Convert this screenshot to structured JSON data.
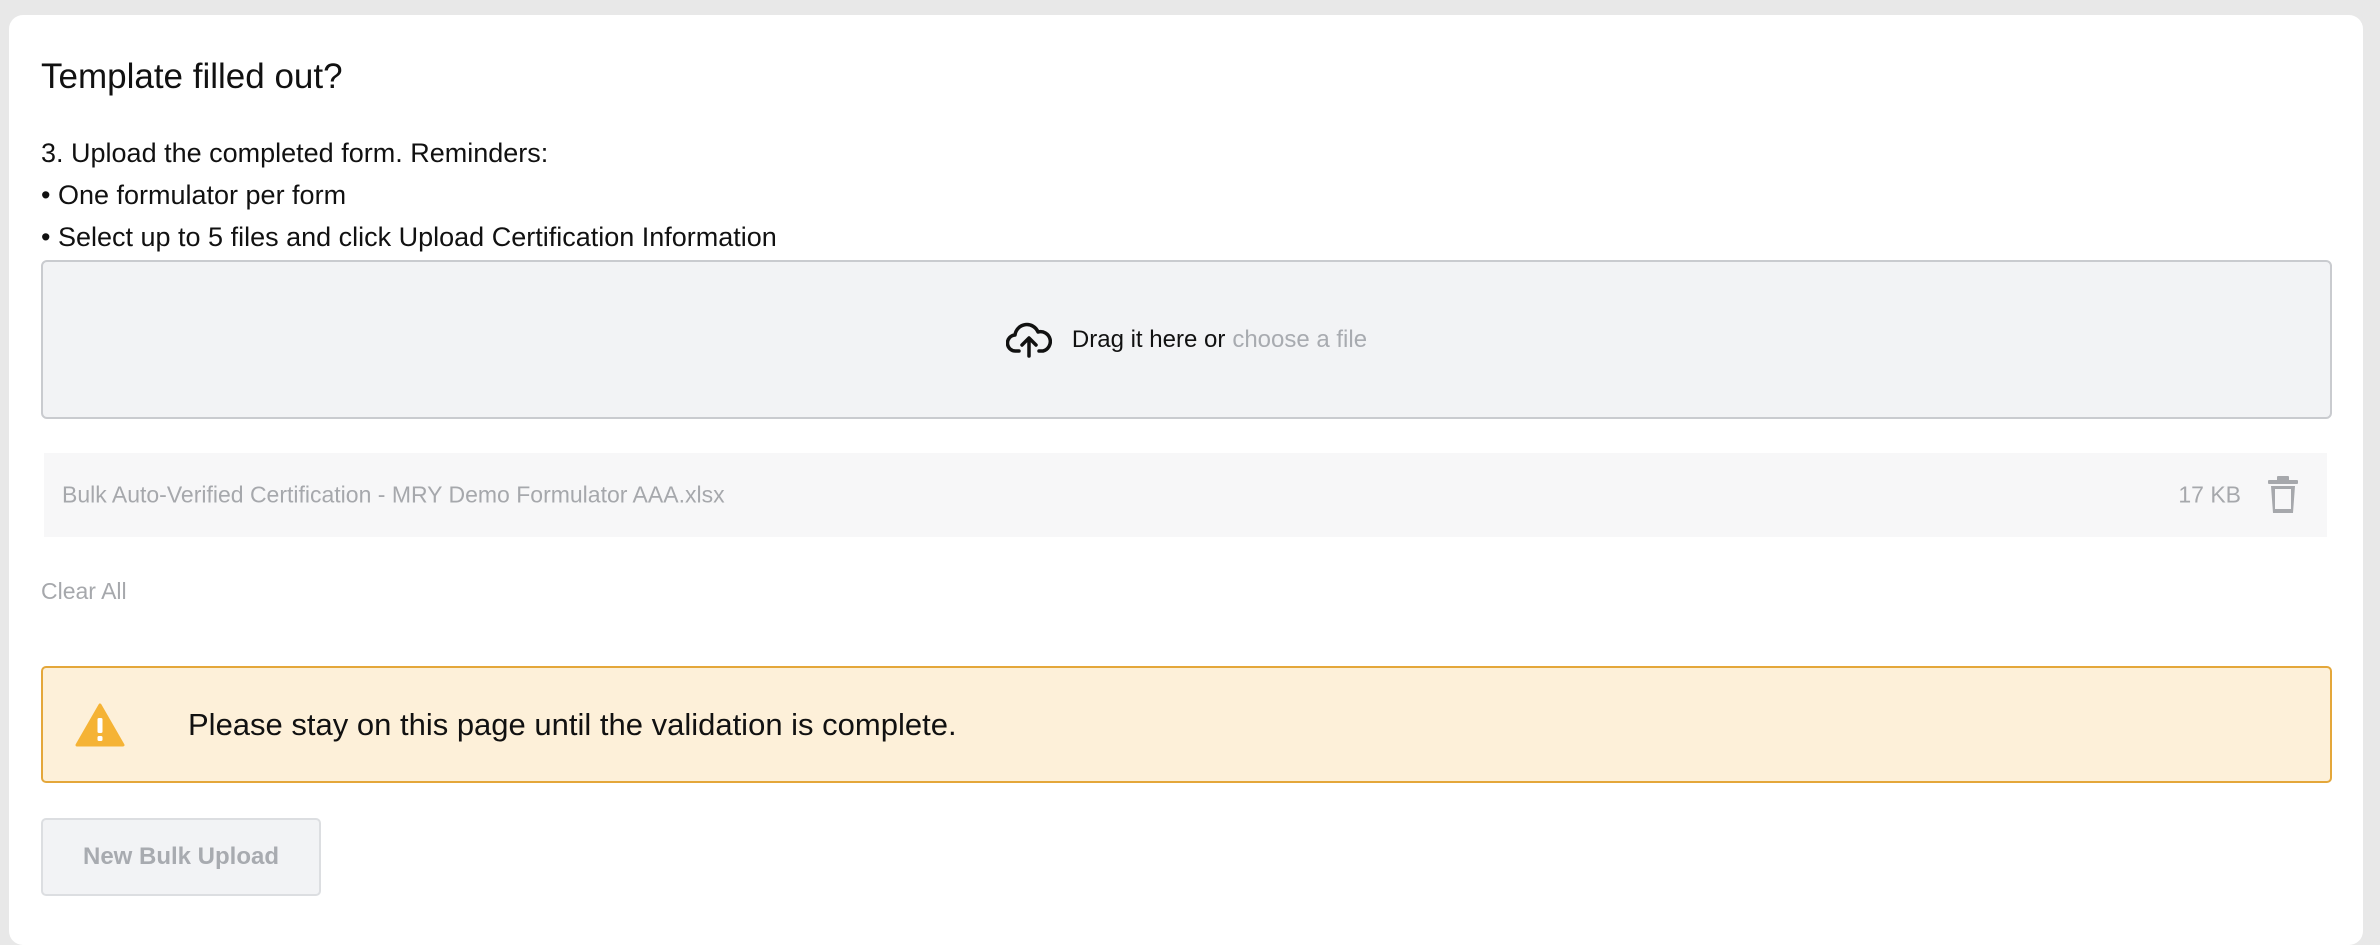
{
  "section": {
    "title": "Template filled out?",
    "instructions": [
      "3. Upload the completed form. Reminders:",
      "• One formulator per form",
      "• Select up to 5 files and click Upload Certification Information"
    ]
  },
  "dropzone": {
    "icon": "cloud-upload-icon",
    "text": "Drag it here or",
    "link": "choose a file"
  },
  "file": {
    "name": "Bulk Auto-Verified Certification - MRY Demo Formulator AAA.xlsx",
    "size": "17 KB",
    "delete_icon": "trash-icon"
  },
  "clear_all": "Clear All",
  "alert": {
    "icon": "warning-icon",
    "message": "Please stay on this page until the validation is complete.",
    "background": "#fdf0d9",
    "border": "#e4a73a",
    "icon_color": "#f5b335"
  },
  "actions": {
    "new_bulk_upload": "New Bulk Upload"
  }
}
